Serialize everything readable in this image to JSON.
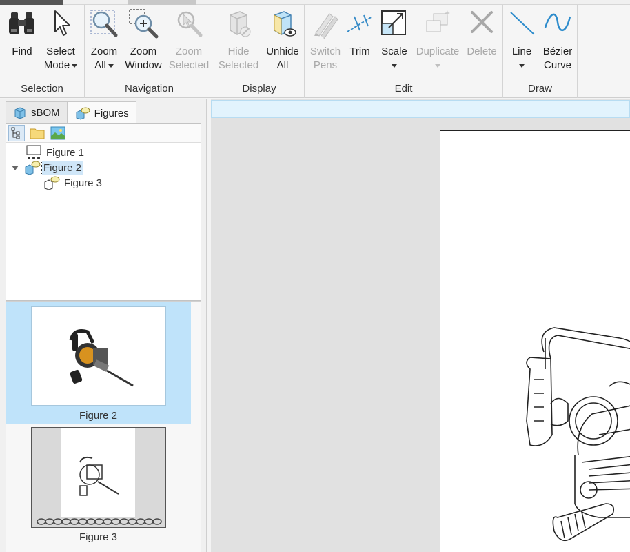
{
  "ribbon": {
    "groups": {
      "selection": "Selection",
      "navigation": "Navigation",
      "display": "Display",
      "edit": "Edit",
      "draw": "Draw"
    },
    "buttons": {
      "find": [
        "Find"
      ],
      "select_mode": [
        "Select",
        "Mode"
      ],
      "zoom_all": [
        "Zoom",
        "All"
      ],
      "zoom_window": [
        "Zoom",
        "Window"
      ],
      "zoom_selected": [
        "Zoom",
        "Selected"
      ],
      "hide_selected": [
        "Hide",
        "Selected"
      ],
      "unhide_all": [
        "Unhide",
        "All"
      ],
      "switch_pens": [
        "Switch",
        "Pens"
      ],
      "trim": [
        "Trim"
      ],
      "scale": [
        "Scale"
      ],
      "duplicate": [
        "Duplicate"
      ],
      "delete": [
        "Delete"
      ],
      "line": [
        "Line"
      ],
      "bezier_curve": [
        "Bézier",
        "Curve"
      ]
    },
    "icons": {
      "find": "binoculars-icon",
      "select_mode": "cursor-arrow-icon",
      "zoom_all": "magnifier-icon",
      "zoom_window": "zoom-window-icon",
      "zoom_selected": "zoom-selected-icon",
      "hide_selected": "hide-cube-icon",
      "unhide_all": "unhide-cube-icon",
      "switch_pens": "pens-icon",
      "trim": "trim-icon",
      "scale": "scale-icon",
      "duplicate": "duplicate-icon",
      "delete": "delete-x-icon",
      "line": "line-icon",
      "bezier_curve": "bezier-curve-icon"
    }
  },
  "panel": {
    "tabs": [
      "sBOM",
      "Figures"
    ],
    "active_tab": "Figures",
    "tree": [
      "Figure 1",
      "Figure 2",
      "Figure 3"
    ],
    "selected": "Figure 2",
    "thumbnails": [
      "Figure 2",
      "Figure 3"
    ]
  },
  "colors": {
    "accent": "#bfe3fa",
    "canvas_bg": "#e1e1e1",
    "ribbon_bg": "#f5f5f5",
    "disabled_text": "#a9a9a9"
  }
}
